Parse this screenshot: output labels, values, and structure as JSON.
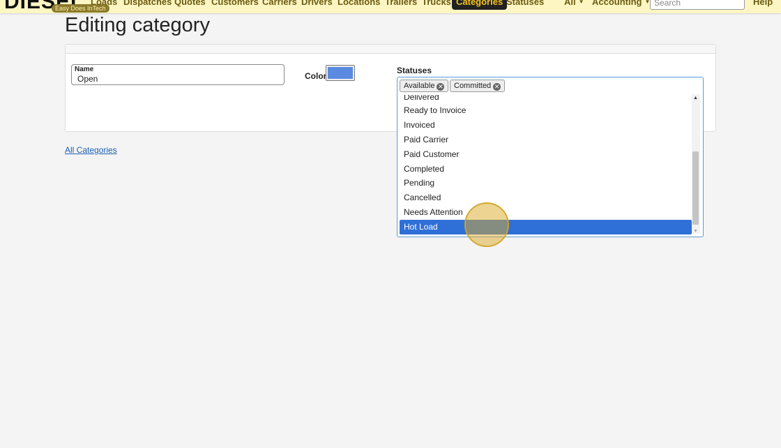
{
  "brand": {
    "logo_text": "DIESEL",
    "tagline": "Easy Does InTech"
  },
  "nav": {
    "items": [
      {
        "label": "Loads"
      },
      {
        "label": "Dispatches"
      },
      {
        "label": "Quotes"
      },
      {
        "label": "Customers"
      },
      {
        "label": "Carriers"
      },
      {
        "label": "Drivers"
      },
      {
        "label": "Locations"
      },
      {
        "label": "Trailers"
      },
      {
        "label": "Trucks"
      },
      {
        "label": "Categories"
      },
      {
        "label": "Statuses"
      }
    ],
    "active": "Categories",
    "scope_dropdown": "All",
    "accounting_dropdown": "Accounting",
    "search_placeholder": "Search",
    "help": "Help"
  },
  "page": {
    "title": "Editing category"
  },
  "form": {
    "name_label": "Name",
    "name_value": "Open",
    "color_label": "Color",
    "color_value": "#5b8be0",
    "statuses_label": "Statuses",
    "selected_statuses": [
      "Available",
      "Committed"
    ],
    "remove_icon": "x-circle-icon",
    "status_options": [
      "Delivered",
      "Ready to Invoice",
      "Invoiced",
      "Paid Carrier",
      "Paid Customer",
      "Completed",
      "Pending",
      "Cancelled",
      "Needs Attention",
      "Hot Load"
    ],
    "highlighted_option": "Hot Load"
  },
  "links": {
    "all_categories": "All Categories"
  },
  "colors": {
    "navbar_bg": "#fdf6c3",
    "active_nav_bg": "#222222",
    "active_nav_text": "#f5c518",
    "selected_option_bg": "#2f6fd8",
    "link": "#1a5fb4"
  }
}
